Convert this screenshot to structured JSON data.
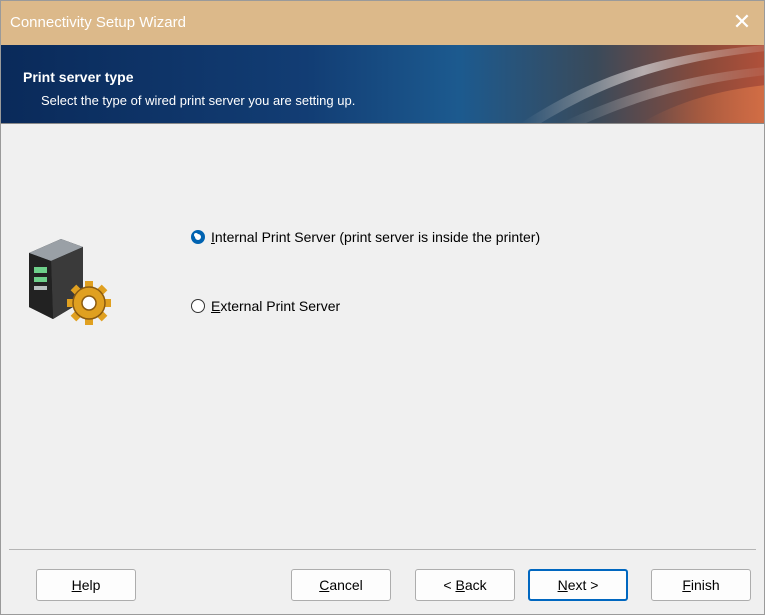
{
  "window": {
    "title": "Connectivity Setup Wizard",
    "close_glyph": "✕"
  },
  "banner": {
    "heading": "Print server type",
    "subheading": "Select the type of wired print server you are setting up."
  },
  "options": [
    {
      "mnemonic": "I",
      "rest": "nternal Print Server (print server is inside the printer)",
      "checked": true
    },
    {
      "mnemonic": "E",
      "rest": "xternal Print Server",
      "checked": false
    }
  ],
  "buttons": {
    "help": {
      "mnemonic": "H",
      "rest": "elp"
    },
    "cancel": {
      "mnemonic": "C",
      "rest": "ancel"
    },
    "back": {
      "prefix": "< ",
      "mnemonic": "B",
      "rest": "ack"
    },
    "next": {
      "mnemonic": "N",
      "rest": "ext >"
    },
    "finish": {
      "mnemonic": "F",
      "rest": "inish"
    }
  },
  "colors": {
    "titlebar": "#dcb98a",
    "accent": "#0067c0",
    "banner_dark": "#0a2a5a"
  },
  "icons": {
    "window_icon": "close-icon",
    "illustration": "printer-gear-icon"
  }
}
